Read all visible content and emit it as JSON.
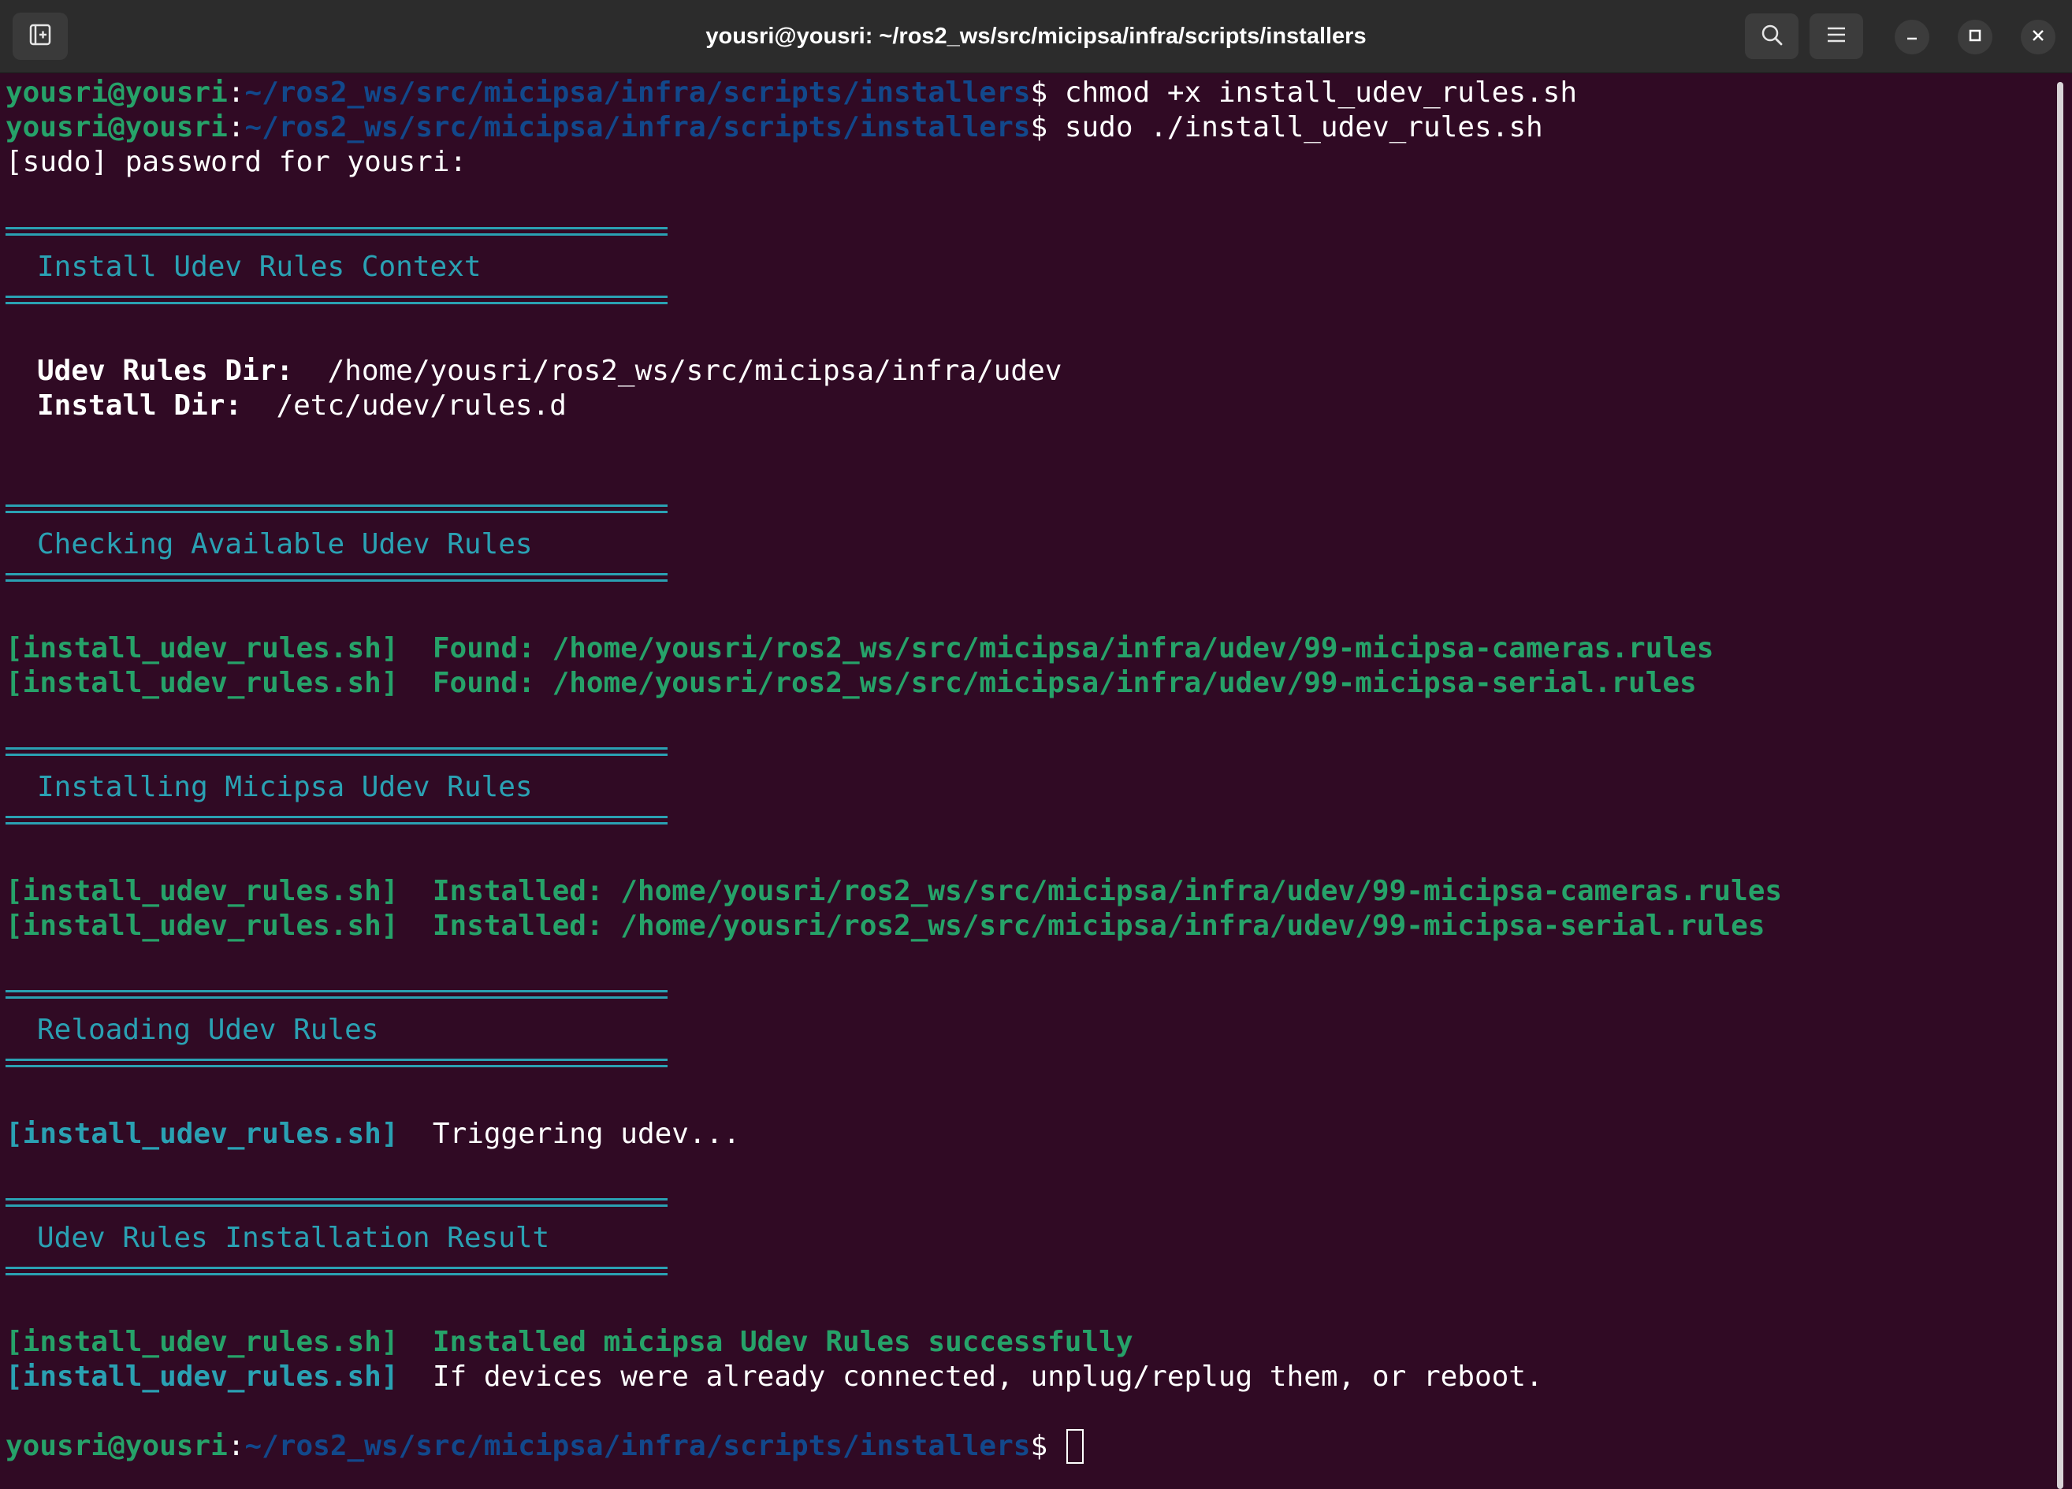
{
  "window": {
    "title": "yousri@yousri: ~/ros2_ws/src/micipsa/infra/scripts/installers"
  },
  "prompt": {
    "user_host": "yousri@yousri",
    "colon": ":",
    "path": "~/ros2_ws/src/micipsa/infra/scripts/installers",
    "symbol": "$ "
  },
  "commands": [
    "chmod +x install_udev_rules.sh",
    "sudo ./install_udev_rules.sh"
  ],
  "sudo_prompt": "[sudo] password for yousri:",
  "script_tag": "[install_udev_rules.sh]",
  "sections": {
    "context": {
      "heading": "Install Udev Rules Context",
      "rules_dir_label": "Udev Rules Dir:",
      "rules_dir_value": "/home/yousri/ros2_ws/src/micipsa/infra/udev",
      "install_dir_label": "Install Dir:",
      "install_dir_value": "/etc/udev/rules.d"
    },
    "checking": {
      "heading": "Checking Available Udev Rules",
      "lines": [
        "Found: /home/yousri/ros2_ws/src/micipsa/infra/udev/99-micipsa-cameras.rules",
        "Found: /home/yousri/ros2_ws/src/micipsa/infra/udev/99-micipsa-serial.rules"
      ]
    },
    "installing": {
      "heading": "Installing Micipsa Udev Rules",
      "lines": [
        "Installed: /home/yousri/ros2_ws/src/micipsa/infra/udev/99-micipsa-cameras.rules",
        "Installed: /home/yousri/ros2_ws/src/micipsa/infra/udev/99-micipsa-serial.rules"
      ]
    },
    "reloading": {
      "heading": "Reloading Udev Rules",
      "line": "Triggering udev..."
    },
    "result": {
      "heading": "Udev Rules Installation Result",
      "success": "Installed micipsa Udev Rules successfully",
      "note": "If devices were already connected, unplug/replug them, or reboot."
    }
  },
  "colors": {
    "background": "#300a24",
    "prompt_green": "#26a269",
    "prompt_path_blue": "#12488b",
    "accent_cyan": "#2aa1b3",
    "titlebar": "#2c2c2c"
  },
  "icons": {
    "new_tab": "new-tab-icon",
    "search": "search-icon",
    "menu": "hamburger-menu-icon",
    "minimize": "minimize-icon",
    "maximize": "maximize-icon",
    "close": "close-icon"
  }
}
